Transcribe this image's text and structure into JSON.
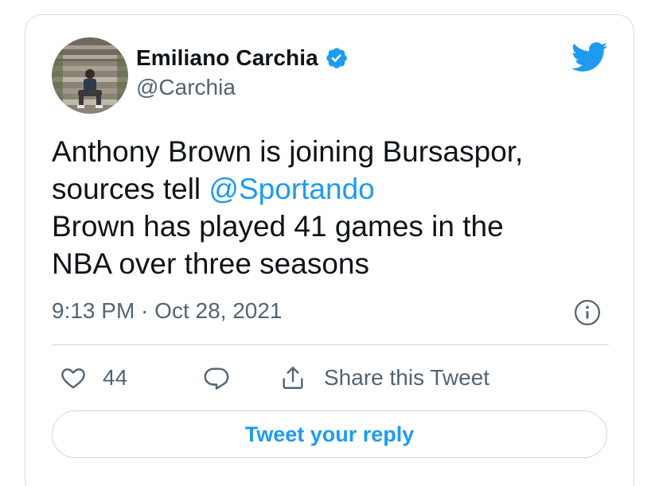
{
  "colors": {
    "accent": "#1d9bf0",
    "text_primary": "#0f1419",
    "text_secondary": "#536471",
    "border": "#cfd9de"
  },
  "author": {
    "display_name": "Emiliano Carchia",
    "handle": "@Carchia",
    "verified": true,
    "avatar_icon": "profile-photo-man-sitting-on-stone-steps"
  },
  "brand_icon": "twitter-bird-icon",
  "tweet": {
    "lines": [
      {
        "text": "Anthony Brown is joining Bursaspor,"
      },
      {
        "prefix": "sources tell ",
        "mention": "@Sportando"
      },
      {
        "text": "Brown has played 41 games in the"
      },
      {
        "text": "NBA over three seasons"
      }
    ],
    "timestamp": "9:13 PM · Oct 28, 2021"
  },
  "actions": {
    "like_count": "44",
    "share_label": "Share this Tweet"
  },
  "reply_button": {
    "label": "Tweet your reply"
  }
}
